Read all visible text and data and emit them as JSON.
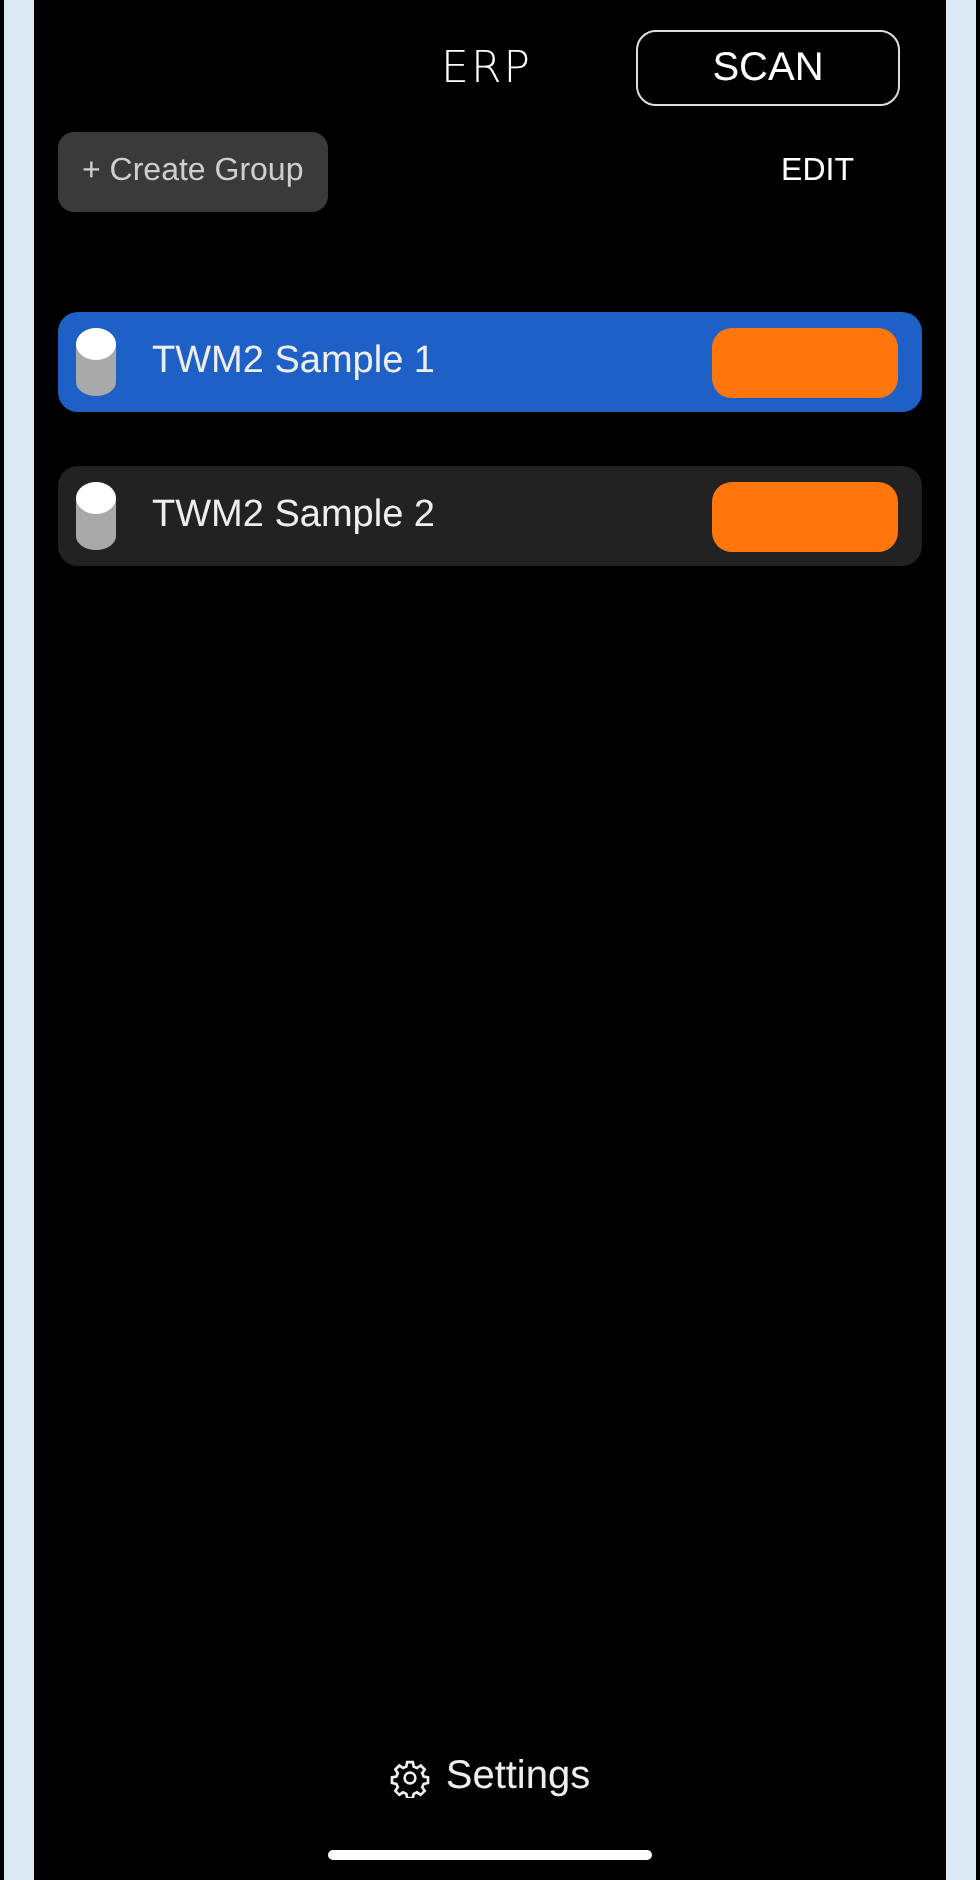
{
  "header": {
    "logo": "ERP",
    "scan_button": "SCAN"
  },
  "toolbar": {
    "create_group_button": "+ Create Group",
    "edit_button": "EDIT"
  },
  "devices": [
    {
      "name": "TWM2 Sample 1",
      "selected": true
    },
    {
      "name": "TWM2 Sample 2",
      "selected": false
    }
  ],
  "footer": {
    "settings_button": "Settings"
  }
}
